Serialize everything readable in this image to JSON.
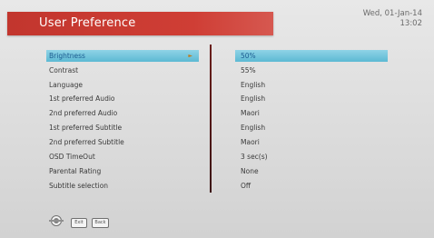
{
  "header": {
    "title": "User Preference",
    "date": "Wed, 01-Jan-14",
    "time": "13:02"
  },
  "settings": [
    {
      "label": "Brightness",
      "value": "50%",
      "selected": true
    },
    {
      "label": "Contrast",
      "value": "55%"
    },
    {
      "label": "Language",
      "value": "English"
    },
    {
      "label": "1st preferred Audio",
      "value": "English"
    },
    {
      "label": "2nd preferred Audio",
      "value": "Maori"
    },
    {
      "label": "1st preferred Subtitle",
      "value": "English"
    },
    {
      "label": "2nd preferred Subtitle",
      "value": "Maori"
    },
    {
      "label": "OSD TimeOut",
      "value": "3 sec(s)"
    },
    {
      "label": "Parental Rating",
      "value": "None"
    },
    {
      "label": "Subtitle selection",
      "value": "Off"
    }
  ],
  "footer": {
    "keys": [
      "Exit",
      "Back"
    ],
    "nav_icon": "navigation-wheel-icon"
  },
  "colors": {
    "title_bar": "#c93a31",
    "selection": "#6fc3db",
    "divider": "#4d1514"
  }
}
